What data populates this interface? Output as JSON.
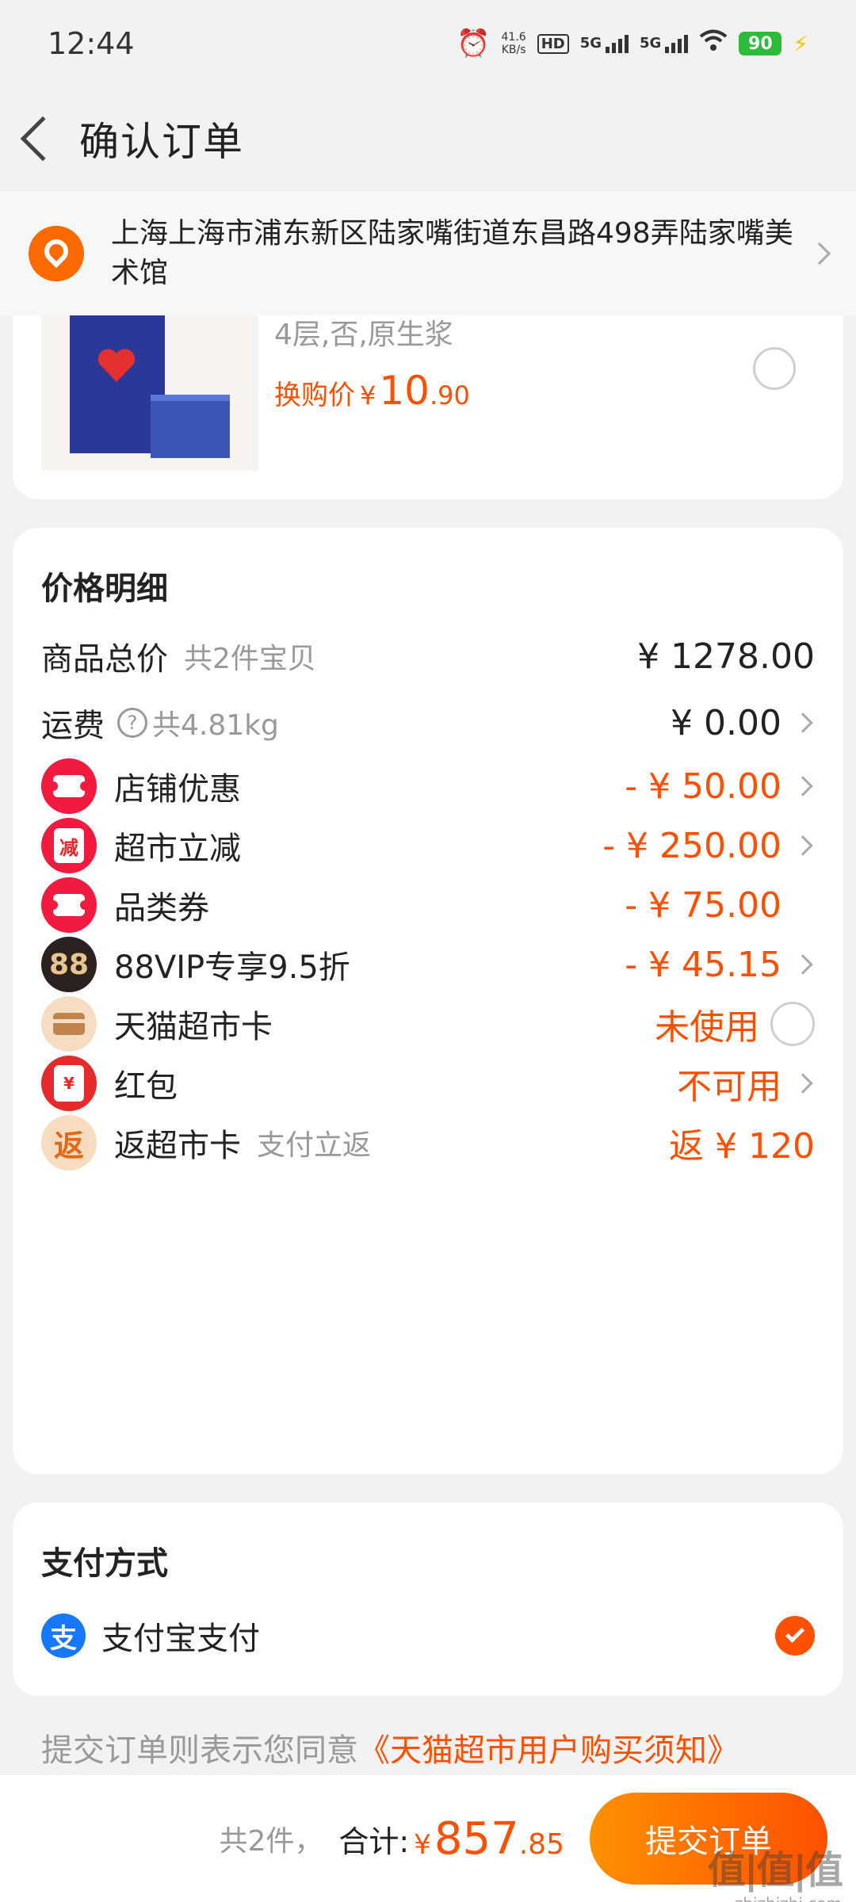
{
  "status_bar": {
    "time": "12:44",
    "net_speed": "41.6",
    "net_unit": "KB/s",
    "hd": "HD",
    "sim1": "5G",
    "sim2": "5G",
    "battery": "90"
  },
  "header": {
    "title": "确认订单"
  },
  "address": {
    "text": "上海上海市浦东新区陆家嘴街道东昌路498弄陆家嘴美术馆"
  },
  "product": {
    "spec": "4层,否,原生浆",
    "price_label": "换购价",
    "currency": "¥",
    "price_int": "10",
    "price_dec": ".90"
  },
  "price_detail": {
    "title": "价格明细",
    "rows": [
      {
        "label": "商品总价",
        "sub": "共2件宝贝",
        "amount": "¥ 1278.00"
      },
      {
        "label": "运费",
        "sub": "共4.81kg",
        "amount": "¥ 0.00"
      },
      {
        "label": "店铺优惠",
        "amount": "- ¥ 50.00"
      },
      {
        "label": "超市立减",
        "amount": "- ¥ 250.00"
      },
      {
        "label": "品类券",
        "amount": "- ¥ 75.00"
      },
      {
        "label": "88VIP专享9.5折",
        "amount": "- ¥ 45.15"
      },
      {
        "label": "天猫超市卡",
        "amount": "未使用"
      },
      {
        "label": "红包",
        "amount": "不可用"
      },
      {
        "label": "返超市卡",
        "sub": "支付立返",
        "amount": "返 ¥ 120"
      }
    ],
    "icon_text": {
      "jian": "减",
      "vip": "88",
      "hongbao": "¥",
      "fan": "返",
      "question": "?"
    }
  },
  "payment": {
    "title": "支付方式",
    "method": "支付宝支付",
    "icon_text": "支"
  },
  "agreement": {
    "prefix": "提交订单则表示您同意",
    "link": "《天猫超市用户购买须知》"
  },
  "bottom": {
    "count": "共2件，",
    "total_label": "合计:",
    "currency": "¥",
    "total_int": "857",
    "total_dec": ".85",
    "submit": "提交订单"
  },
  "watermark": {
    "big": "值|值|值",
    "small": "zhizhizhi.com"
  },
  "colors": {
    "accent": "#ff5000",
    "alipay": "#1677ff"
  }
}
